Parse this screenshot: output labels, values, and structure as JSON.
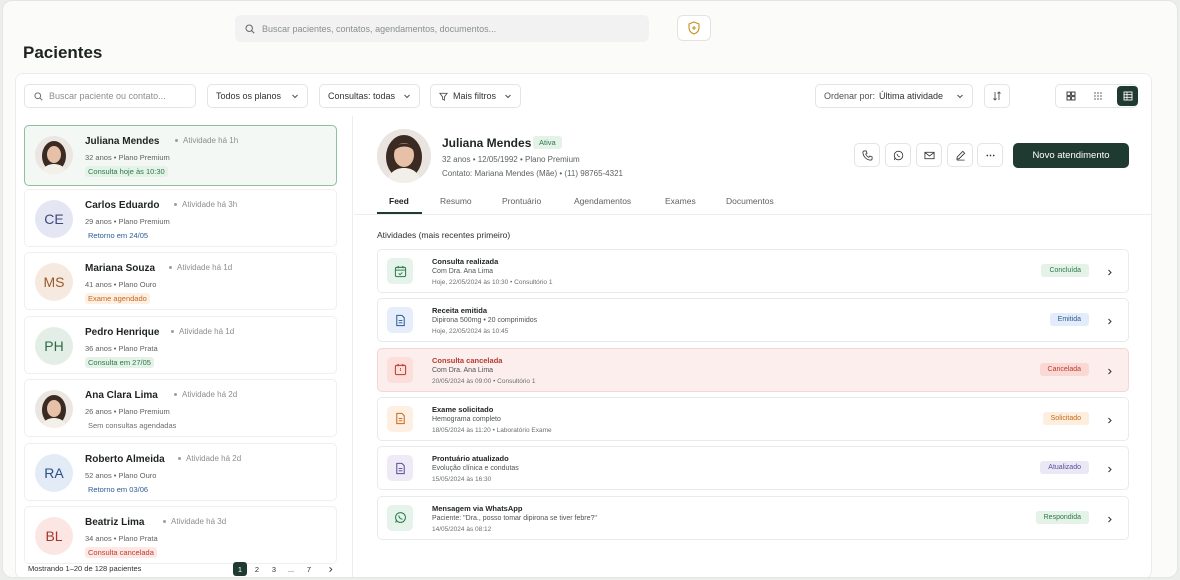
{
  "top": {
    "search_placeholder": "Buscar pacientes, contatos, agendamentos, documentos..."
  },
  "page_title": "Pacientes",
  "filters": {
    "search_placeholder": "Buscar paciente ou contato...",
    "plans": "Todos os planos",
    "consults": "Consultas: todas",
    "more": "Mais filtros",
    "order_label": "Ordenar por:",
    "order_value": "Última atividade"
  },
  "patients": [
    {
      "name": "Juliana Mendes",
      "initials": "",
      "activity": "Atividade há 1h",
      "meta": "32 anos • Plano Premium",
      "tag": "Consulta hoje às 10:30",
      "tag_color": "green"
    },
    {
      "name": "Carlos Eduardo",
      "initials": "CE",
      "activity": "Atividade há 3h",
      "meta": "29 anos • Plano Premium",
      "tag": "Retorno em 24/05",
      "tag_color": "blue"
    },
    {
      "name": "Mariana Souza",
      "initials": "MS",
      "activity": "Atividade há 1d",
      "meta": "41 anos • Plano Ouro",
      "tag": "Exame agendado",
      "tag_color": "orange"
    },
    {
      "name": "Pedro Henrique",
      "initials": "PH",
      "activity": "Atividade há 1d",
      "meta": "36 anos • Plano Prata",
      "tag": "Consulta em 27/05",
      "tag_color": "green"
    },
    {
      "name": "Ana Clara Lima",
      "initials": "",
      "activity": "Atividade há 2d",
      "meta": "26 anos • Plano Premium",
      "tag": "Sem consultas agendadas",
      "tag_color": "grey"
    },
    {
      "name": "Roberto Almeida",
      "initials": "RA",
      "activity": "Atividade há 2d",
      "meta": "52 anos • Plano Ouro",
      "tag": "Retorno em 03/06",
      "tag_color": "blue"
    },
    {
      "name": "Beatriz Lima",
      "initials": "BL",
      "activity": "Atividade há 3d",
      "meta": "34 anos • Plano Prata",
      "tag": "Consulta cancelada",
      "tag_color": "red"
    }
  ],
  "list_footer": "Mostrando 1–20 de 128 pacientes",
  "pagination": [
    "1",
    "2",
    "3",
    "...",
    "7"
  ],
  "detail": {
    "name": "Juliana Mendes",
    "status": "Ativa",
    "line1": "32 anos  •  12/05/1992  •  Plano Premium",
    "line2": "Contato: Mariana Mendes (Mãe)  •  (11) 98765-4321",
    "primary_action": "Novo atendimento"
  },
  "tabs": [
    "Feed",
    "Resumo",
    "Prontuário",
    "Agendamentos",
    "Exames",
    "Documentos"
  ],
  "feed_title": "Atividades (mais recentes primeiro)",
  "feed": [
    {
      "title": "Consulta realizada",
      "sub": "Com Dra. Ana Lima",
      "date": "Hoje, 22/05/2024 às 10:30  •  Consultório 1",
      "status": "Concluída",
      "kind": "calendar",
      "color": "#2b7a4b",
      "bg": "#e6f3ea"
    },
    {
      "title": "Receita emitida",
      "sub": "Dipirona 500mg  •  20 comprimidos",
      "date": "Hoje, 22/05/2024 às 10:45",
      "status": "Emitida",
      "kind": "doc",
      "color": "#2c5b94",
      "bg": "#e5eefa"
    },
    {
      "title": "Consulta cancelada",
      "sub": "Com Dra. Ana Lima",
      "date": "20/05/2024 às 09:00  •  Consultório 1",
      "status": "Cancelada",
      "kind": "cancel",
      "color": "#c0392b",
      "bg": "#fcdedb"
    },
    {
      "title": "Exame solicitado",
      "sub": "Hemograma completo",
      "date": "18/05/2024 às 11:20  •  Laboratório Exame",
      "status": "Solicitado",
      "kind": "doc",
      "color": "#c56a1e",
      "bg": "#fdf0e3"
    },
    {
      "title": "Prontuário atualizado",
      "sub": "Evolução clínica e condutas",
      "date": "15/05/2024 às 16:30",
      "status": "Atualizado",
      "kind": "doc",
      "color": "#5b4b9a",
      "bg": "#eeebf7"
    },
    {
      "title": "Mensagem via WhatsApp",
      "sub": "Paciente: \"Dra., posso tomar dipirona se tiver febre?\"",
      "date": "14/05/2024 às 08:12",
      "status": "Respondida",
      "kind": "whatsapp",
      "color": "#2b7a4b",
      "bg": "#e6f3ea"
    }
  ]
}
